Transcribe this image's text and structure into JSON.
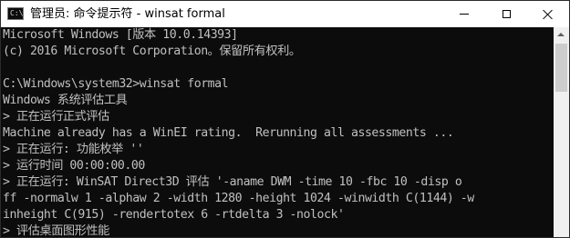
{
  "window": {
    "title": "管理员: 命令提示符 - winsat  formal",
    "icon_name": "cmd-icon",
    "icon_glyph": "C:\\"
  },
  "console": {
    "lines": [
      "Microsoft Windows [版本 10.0.14393]",
      "(c) 2016 Microsoft Corporation。保留所有权利。",
      "",
      "C:\\Windows\\system32>winsat formal",
      "Windows 系统评估工具",
      "> 正在运行正式评估",
      "Machine already has a WinEI rating.  Rerunning all assessments ...",
      "> 正在运行: 功能枚举 ''",
      "> 运行时间 00:00:00.00",
      "> 正在运行: WinSAT Direct3D 评估 '-aname DWM -time 10 -fbc 10 -disp o",
      "ff -normalw 1 -alphaw 2 -width 1280 -height 1024 -winwidth C(1144) -w",
      "inheight C(915) -rendertotex 6 -rtdelta 3 -nolock'",
      "> 评估桌面图形性能"
    ],
    "text_color": "#c0c0c0",
    "background_color": "#0c0c0c"
  }
}
